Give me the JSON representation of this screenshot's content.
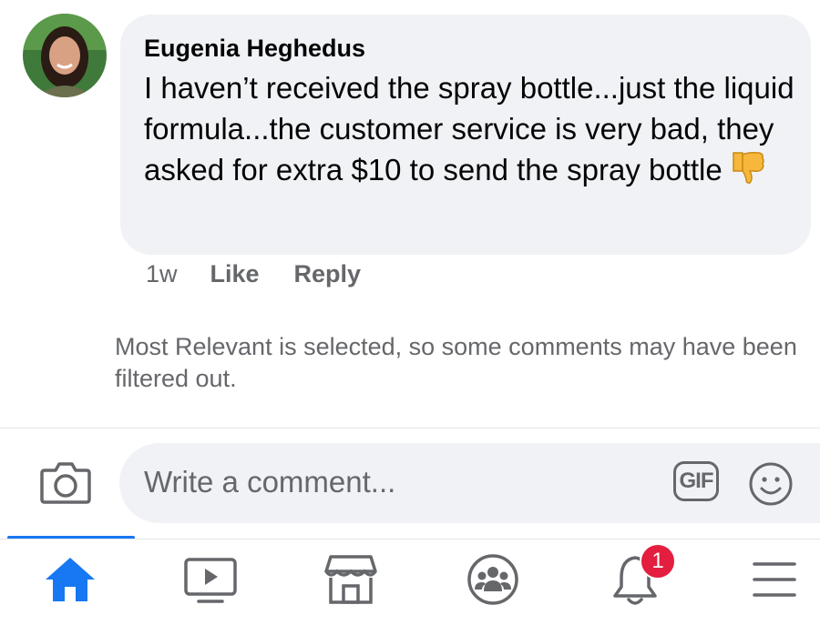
{
  "comment": {
    "author": "Eugenia Heghedus",
    "text": "I haven’t received the spray bottle...just the liquid formula...the customer service is very bad, they asked for extra $10 to send the spray bottle",
    "reaction_emoji": "thumbs-down-emoji",
    "time": "1w",
    "like_label": "Like",
    "reply_label": "Reply"
  },
  "filter_notice": "Most Relevant is selected, so some comments may have been filtered out.",
  "composer": {
    "placeholder": "Write a comment...",
    "gif_label": "GIF",
    "camera_icon": "camera-icon",
    "emoji_icon": "smiley-icon"
  },
  "tabbar": {
    "active_tab": "home",
    "tabs": [
      "home",
      "watch",
      "marketplace",
      "groups",
      "notifications",
      "menu"
    ],
    "notification_count": "1"
  },
  "colors": {
    "accent": "#1877f2",
    "badge": "#e41e3f",
    "bubble": "#f0f2f5",
    "secondary_text": "#65676b"
  }
}
